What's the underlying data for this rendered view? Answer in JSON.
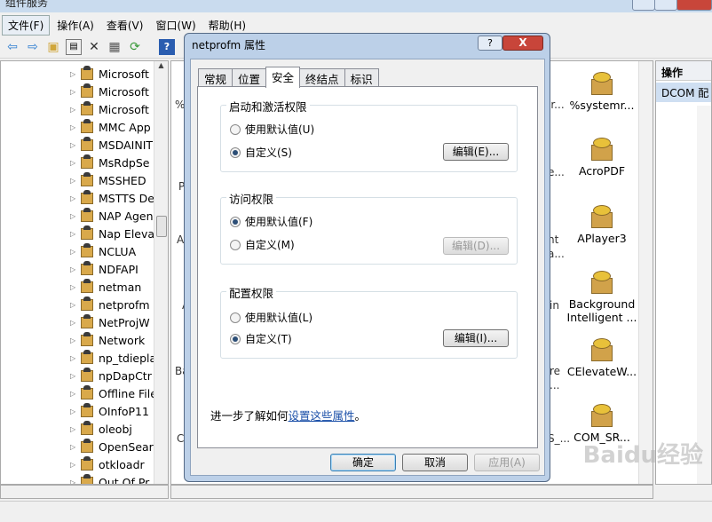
{
  "window": {
    "title": "组件服务"
  },
  "menu": [
    "文件(F)",
    "操作(A)",
    "查看(V)",
    "窗口(W)",
    "帮助(H)"
  ],
  "toolbar_icons": [
    "back-icon",
    "forward-icon",
    "up-folder-icon",
    "show-hide-tree-icon",
    "delete-icon",
    "properties-icon",
    "refresh-icon",
    "help-icon"
  ],
  "tree": {
    "items": [
      "Microsoft",
      "Microsoft",
      "Microsoft",
      "MMC App",
      "MSDAINIT",
      "MsRdpSe",
      "MSSHED",
      "MSTTS De",
      "NAP Agen",
      "Nap Eleva",
      "NCLUA",
      "NDFAPI",
      "netman",
      "netprofm",
      "NetProjW",
      "Network",
      "np_tdiepla",
      "npDapCtr",
      "Offline File",
      "OInfoP11",
      "oleobj",
      "OpenSear",
      "otkloadr",
      "Out Of Pr"
    ]
  },
  "center": {
    "icons": [
      {
        "label": "%systemr..."
      },
      {
        "label": "AcroPDF"
      },
      {
        "label": "APlayer3"
      },
      {
        "label": "Background Intelligent ..."
      },
      {
        "label": "CElevateW..."
      },
      {
        "label": "COM_SR..."
      }
    ],
    "left_fragments": [
      "%",
      "P",
      "A",
      "A",
      "Ba",
      "C"
    ],
    "right_fragments": [
      "ar...",
      "e...",
      "nt",
      "a...",
      "in",
      "re",
      "...",
      "S_..."
    ]
  },
  "actions": {
    "header": "操作",
    "selected": "DCOM 配"
  },
  "watermark": "Baidu经验",
  "dialog": {
    "title": "netprofm 属性",
    "help": "?",
    "close": "X",
    "tabs": [
      "常规",
      "位置",
      "安全",
      "终结点",
      "标识"
    ],
    "active_tab": "安全",
    "groups": [
      {
        "title": "启动和激活权限",
        "options": [
          "使用默认值(U)",
          "自定义(S)"
        ],
        "selected": 1,
        "edit_label": "编辑(E)...",
        "edit_enabled": true
      },
      {
        "title": "访问权限",
        "options": [
          "使用默认值(F)",
          "自定义(M)"
        ],
        "selected": 0,
        "edit_label": "编辑(D)...",
        "edit_enabled": false
      },
      {
        "title": "配置权限",
        "options": [
          "使用默认值(L)",
          "自定义(T)"
        ],
        "selected": 1,
        "edit_label": "编辑(I)...",
        "edit_enabled": true
      }
    ],
    "more_text": "进一步了解如何",
    "more_link": "设置这些属性",
    "more_suffix": "。",
    "buttons": {
      "ok": "确定",
      "cancel": "取消",
      "apply": "应用(A)"
    }
  }
}
